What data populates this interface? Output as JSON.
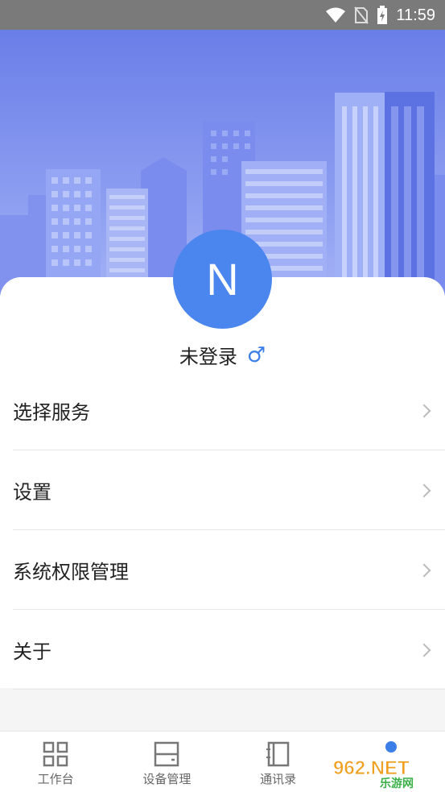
{
  "status_bar": {
    "time": "11:59"
  },
  "profile": {
    "avatar_letter": "N",
    "username": "未登录",
    "gender_icon": "♂"
  },
  "menu": {
    "items": [
      {
        "label": "选择服务"
      },
      {
        "label": "设置"
      },
      {
        "label": "系统权限管理"
      },
      {
        "label": "关于"
      }
    ]
  },
  "tabbar": {
    "tabs": [
      {
        "label": "工作台",
        "icon": "grid-icon"
      },
      {
        "label": "设备管理",
        "icon": "device-icon"
      },
      {
        "label": "通讯录",
        "icon": "contacts-icon"
      },
      {
        "label": "",
        "icon": "profile-icon"
      }
    ]
  },
  "watermark": {
    "text": "962.NET",
    "subtext": "乐游网"
  },
  "colors": {
    "accent": "#4a86ee",
    "hero": "#7a8ced"
  }
}
